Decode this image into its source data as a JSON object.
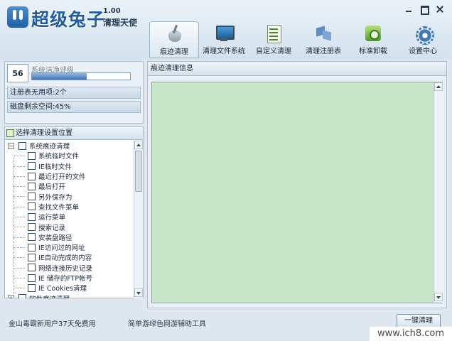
{
  "app": {
    "logo_text": "超级兔子",
    "version": "1.00",
    "subtitle": "清理天使"
  },
  "window_controls": [
    "minimize",
    "maximize",
    "close"
  ],
  "tabs": [
    {
      "label": "痕迹清理",
      "icon": "broom-icon",
      "active": true
    },
    {
      "label": "清理文件系统",
      "icon": "monitor-icon",
      "active": false
    },
    {
      "label": "自定义清理",
      "icon": "checklist-icon",
      "active": false
    },
    {
      "label": "清理注册表",
      "icon": "cubes-icon",
      "active": false
    },
    {
      "label": "标准卸载",
      "icon": "uninstall-disc-icon",
      "active": false
    },
    {
      "label": "设置中心",
      "icon": "gear-icon",
      "active": false
    }
  ],
  "status": {
    "score": "56",
    "score_label": "系统洁净评级",
    "progress_value": 0.56,
    "registry_line": "注册表无用项:2个",
    "disk_line": "磁盘剩余空间:45%"
  },
  "tree": {
    "header": "选择清理设置位置",
    "root_label": "系统痕迹清理",
    "items": [
      "系统临时文件",
      "IE临时文件",
      "最近打开的文件",
      "最后打开",
      "另外保存为",
      "查找文件菜单",
      "运行菜单",
      "搜索记录",
      "安装盘路径",
      "IE访问过的网址",
      "IE自动完成的内容",
      "网络连接历史记录",
      "IE 储存的FTP帐号",
      "IE Cookies清理"
    ],
    "next_root_partial": "软件痕迹清理"
  },
  "main": {
    "header": "痕迹清理信息",
    "area_color": "#c8e6c8"
  },
  "footer": {
    "left_text": "金山毒霸新用户37天免费用",
    "mid_text": "简单游绿色网游辅助工具",
    "clean_button": "一键清理"
  },
  "watermark": "www.ich8.com"
}
